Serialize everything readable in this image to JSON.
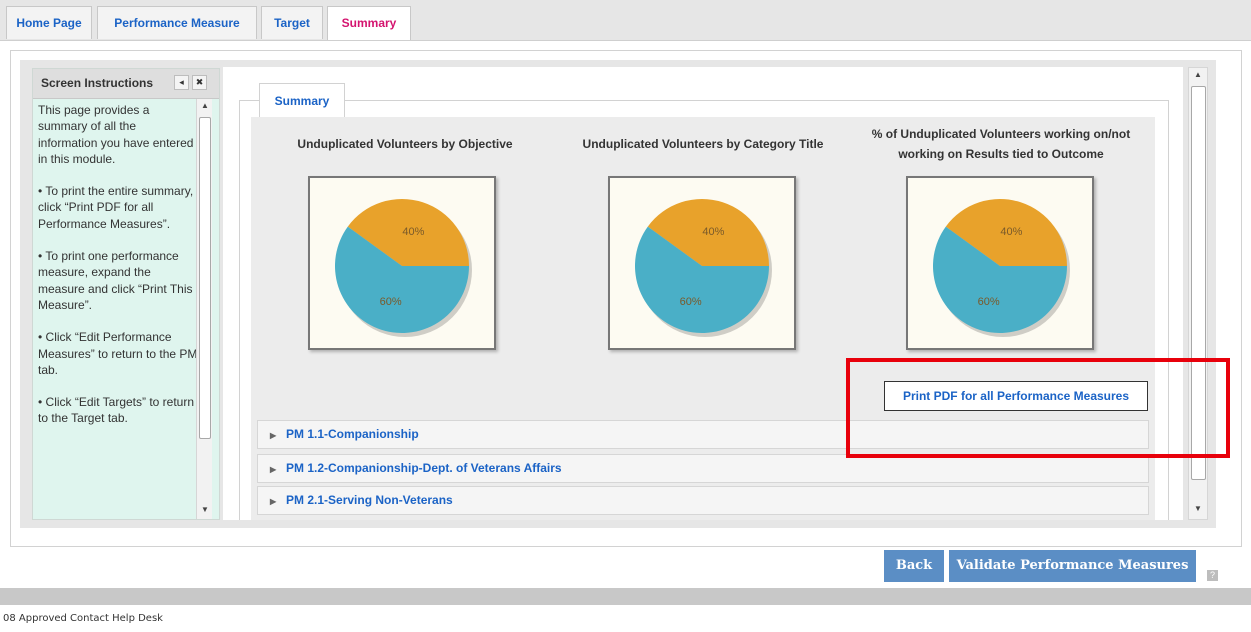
{
  "tabs": [
    {
      "label": "Home Page"
    },
    {
      "label": "Performance Measure"
    },
    {
      "label": "Target"
    },
    {
      "label": "Summary",
      "active": true
    }
  ],
  "instructions": {
    "title": "Screen Instructions",
    "collapse_glyph": "◂",
    "close_glyph": "✖",
    "paragraphs": [
      "This page provides a summary of all the information you have entered in this module.",
      "• To print the entire summary, click “Print PDF for all Performance Measures”.",
      "• To print one performance measure, expand the measure and click “Print This Measure”.",
      "• Click “Edit Performance Measures” to return to the PM tab.",
      "• Click “Edit Targets” to return to the Target tab."
    ]
  },
  "summary": {
    "tab_label": "Summary",
    "charts": [
      {
        "title": "Unduplicated Volunteers by Objective",
        "chart_data": {
          "type": "pie",
          "labels": [
            "40%",
            "60%"
          ],
          "values": [
            40,
            60
          ],
          "colors": [
            "#e8a22b",
            "#4aafc7"
          ]
        }
      },
      {
        "title": "Unduplicated Volunteers by Category Title",
        "chart_data": {
          "type": "pie",
          "labels": [
            "40%",
            "60%"
          ],
          "values": [
            40,
            60
          ],
          "colors": [
            "#e8a22b",
            "#4aafc7"
          ]
        }
      },
      {
        "title": "% of Unduplicated Volunteers working on/not working on Results tied to Outcome",
        "chart_data": {
          "type": "pie",
          "labels": [
            "40%",
            "60%"
          ],
          "values": [
            40,
            60
          ],
          "colors": [
            "#e8a22b",
            "#4aafc7"
          ]
        }
      }
    ],
    "print_button": "Print PDF for all Performance Measures",
    "measures": [
      {
        "label": "PM 1.1-Companionship"
      },
      {
        "label": "PM 1.2-Companionship-Dept. of Veterans Affairs"
      },
      {
        "label": "PM 2.1-Serving Non-Veterans"
      }
    ]
  },
  "buttons": {
    "back": "Back",
    "validate": "Validate Performance Measures",
    "help": "?"
  },
  "footer": {
    "text": "08 Approved Contact Help Desk"
  },
  "colors": {
    "link": "#1b63c6",
    "active_tab": "#d4146f",
    "button": "#5b8ec5",
    "pie_orange": "#e8a22b",
    "pie_blue": "#4aafc7",
    "highlight_box": "#e8000b"
  }
}
